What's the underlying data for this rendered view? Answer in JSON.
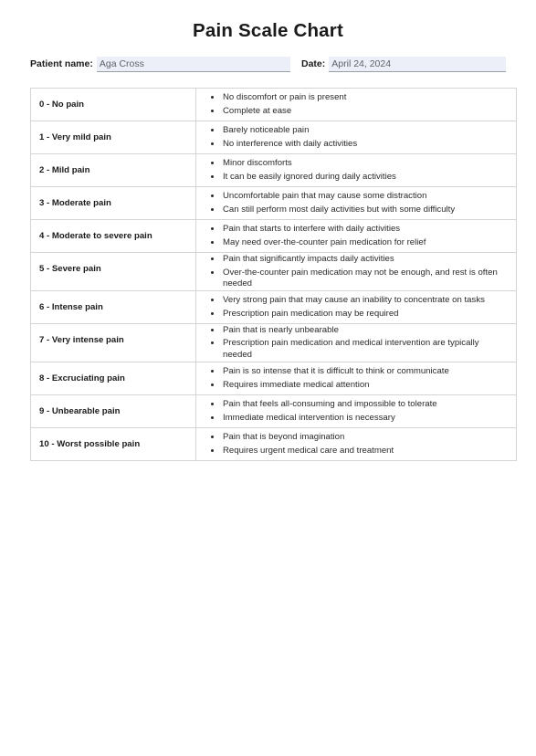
{
  "document": {
    "title": "Pain Scale Chart"
  },
  "form": {
    "patient": {
      "label": "Patient name:",
      "value": "Aga Cross",
      "placeholder": "Patient name"
    },
    "date": {
      "label": "Date:",
      "value": "April 24, 2024",
      "placeholder": "Date"
    }
  },
  "table": {
    "rows": [
      {
        "level": "0 - No pain",
        "items": [
          "No discomfort or pain is present",
          "Complete at ease"
        ]
      },
      {
        "level": "1 - Very mild pain",
        "items": [
          "Barely noticeable pain",
          "No interference with daily activities"
        ]
      },
      {
        "level": "2 - Mild pain",
        "items": [
          "Minor discomforts",
          "It can be easily ignored during daily activities"
        ]
      },
      {
        "level": "3 - Moderate pain",
        "items": [
          "Uncomfortable pain that may cause some distraction",
          "Can still perform most daily activities but with some difficulty"
        ]
      },
      {
        "level": "4 - Moderate to severe pain",
        "items": [
          "Pain that starts to interfere with daily activities",
          "May need over-the-counter pain medication for relief"
        ]
      },
      {
        "level": "5 - Severe pain",
        "items": [
          "Pain that significantly impacts daily activities",
          "Over-the-counter pain medication may not be enough, and rest is often needed"
        ]
      },
      {
        "level": "6 - Intense pain",
        "items": [
          "Very strong pain that may cause an inability to concentrate on tasks",
          "Prescription pain medication may be required"
        ]
      },
      {
        "level": "7 - Very intense pain",
        "items": [
          "Pain that is nearly unbearable",
          "Prescription pain medication and medical intervention are typically needed"
        ]
      },
      {
        "level": "8 - Excruciating pain",
        "items": [
          "Pain is so intense that it is difficult to think or communicate",
          "Requires immediate medical attention"
        ]
      },
      {
        "level": "9 - Unbearable pain",
        "items": [
          "Pain that feels all-consuming and impossible to tolerate",
          "Immediate medical intervention is necessary"
        ]
      },
      {
        "level": "10 - Worst possible pain",
        "items": [
          "Pain that is beyond imagination",
          "Requires urgent medical care and treatment"
        ]
      }
    ]
  },
  "colors": {
    "field_background": "#eceef8",
    "field_underline": "#9aa0aa",
    "table_border": "#d4d4d4",
    "text": "#222222",
    "value_text": "#5f6368"
  }
}
